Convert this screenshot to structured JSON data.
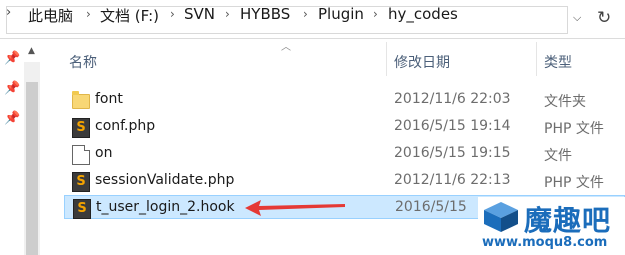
{
  "address_bar": {
    "breadcrumbs": [
      "此电脑",
      "文档 (F:)",
      "SVN",
      "HYBBS",
      "Plugin",
      "hy_codes"
    ],
    "lead_icon": "chevron-right-icon",
    "dropdown_icon": "chevron-down-icon",
    "refresh_icon": "refresh-icon"
  },
  "columns": {
    "name": "名称",
    "modified": "修改日期",
    "type": "类型"
  },
  "files": [
    {
      "name": "font",
      "modified": "2012/11/6 22:03",
      "type": "文件夹",
      "icon": "folder-icon"
    },
    {
      "name": "conf.php",
      "modified": "2016/5/15 19:14",
      "type": "PHP 文件",
      "icon": "sublime-file-icon"
    },
    {
      "name": "on",
      "modified": "2016/5/15 19:15",
      "type": "文件",
      "icon": "file-icon"
    },
    {
      "name": "sessionValidate.php",
      "modified": "2012/11/6 22:13",
      "type": "PHP 文件",
      "icon": "sublime-file-icon"
    },
    {
      "name": "t_user_login_2.hook",
      "modified": "2016/5/15",
      "type": "",
      "icon": "sublime-file-icon",
      "selected": true
    }
  ],
  "sublime_glyph": "S",
  "watermark": {
    "title": "魔趣吧",
    "url": "www.moqu8.com"
  },
  "colors": {
    "selection_bg": "#cce8ff",
    "selection_border": "#99d1ff",
    "arrow": "#e53935",
    "watermark_blue": "#1b6dbb"
  }
}
